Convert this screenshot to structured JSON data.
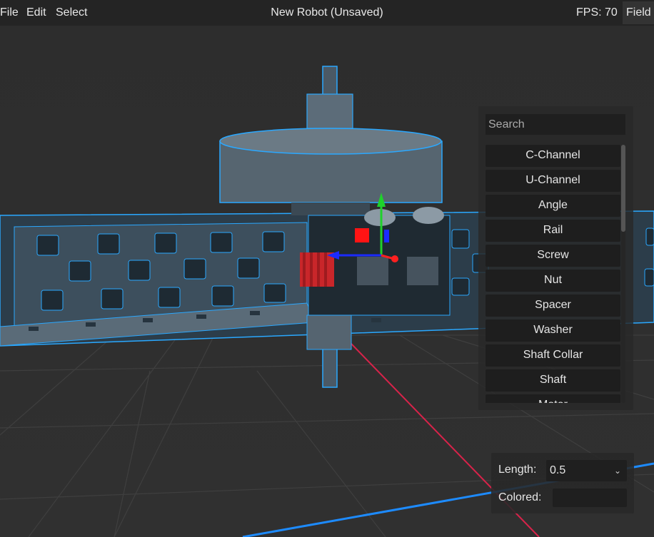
{
  "menu": {
    "file": "File",
    "edit": "Edit",
    "select": "Select"
  },
  "window": {
    "title": "New Robot (Unsaved)",
    "fps": "FPS: 70",
    "field_button": "Field"
  },
  "parts_panel": {
    "search_placeholder": "Search",
    "items": [
      "C-Channel",
      "U-Channel",
      "Angle",
      "Rail",
      "Screw",
      "Nut",
      "Spacer",
      "Washer",
      "Shaft Collar",
      "Shaft",
      "Motor"
    ]
  },
  "properties": {
    "length_label": "Length:",
    "length_value": "0.5",
    "colored_label": "Colored:",
    "colored_value": ""
  },
  "colors": {
    "accent_outline": "#2aa8ff",
    "part_metal": "#56646f",
    "gear_red": "#c9262a",
    "gizmo_green": "#1fd12b",
    "gizmo_blue": "#1b2bff",
    "gizmo_red": "#ff2020"
  },
  "icons": {
    "length_dropdown": "chevron-down-icon",
    "scrollbar": "vertical-scrollbar"
  }
}
